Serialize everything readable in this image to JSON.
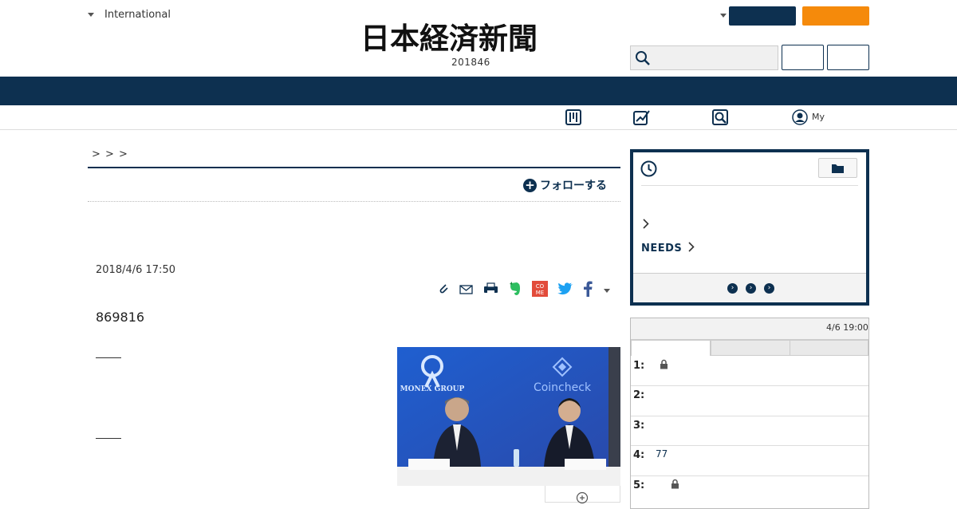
{
  "header": {
    "edition_label": "International",
    "logo_text": "日本経済新聞",
    "logo_subtext": "201846"
  },
  "subnav": {
    "my_label": "My"
  },
  "breadcrumb": {
    "text": ">    > >"
  },
  "article": {
    "follow_label": "フォローする",
    "date": "2018/4/6 17:50",
    "lead_text": "869816",
    "photo_logo_left": "MONEX GROUP",
    "photo_logo_right": "Coincheck"
  },
  "sidebar": {
    "needs_label": "NEEDS",
    "ranking": {
      "time": "4/6 19:00",
      "rows": [
        {
          "num": "1:",
          "text": "",
          "locked": true
        },
        {
          "num": "2:",
          "text": "",
          "locked": false
        },
        {
          "num": "3:",
          "text": "",
          "locked": false
        },
        {
          "num": "4:",
          "text": "77",
          "locked": false
        },
        {
          "num": "5:",
          "text": "",
          "locked": true
        }
      ]
    }
  },
  "colors": {
    "navy": "#0d3050",
    "orange": "#f58a0b"
  },
  "icons": [
    "caret-down-icon",
    "search-icon",
    "dashboard-icon",
    "chart-icon",
    "magnifier-icon",
    "user-icon",
    "clip-icon",
    "mail-icon",
    "print-icon",
    "evernote-icon",
    "come-icon",
    "twitter-icon",
    "facebook-icon",
    "clock-icon",
    "folder-icon",
    "lock-icon",
    "zoom-icon"
  ]
}
